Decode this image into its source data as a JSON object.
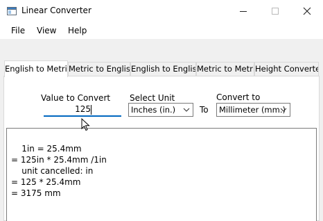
{
  "window": {
    "title": "Linear Converter",
    "icon": "app-icon",
    "controls": [
      "minimize-icon",
      "maximize-icon",
      "close-icon"
    ]
  },
  "menu": {
    "items": [
      "File",
      "View",
      "Help"
    ]
  },
  "tabs": [
    {
      "label": "English to Metric",
      "active": true
    },
    {
      "label": "Metric to English",
      "active": false
    },
    {
      "label": "English to English",
      "active": false
    },
    {
      "label": "Metric to Metric",
      "active": false
    },
    {
      "label": "Height Converter",
      "active": false
    }
  ],
  "form": {
    "value_label": "Value to Convert",
    "value": "125",
    "unit_label": "Select Unit",
    "unit_selected": "Inches (in.)",
    "to_label": "To",
    "convert_label": "Convert to",
    "convert_selected": "Millimeter (mm.)"
  },
  "result": {
    "lines": [
      "    1in = 25.4mm",
      "= 125in * 25.4mm /1in",
      "    unit cancelled: in",
      "= 125 * 25.4mm",
      "= 3175 mm"
    ]
  },
  "colors": {
    "focus_underline": "#0067c0",
    "client_background": "#f0f0f0"
  }
}
